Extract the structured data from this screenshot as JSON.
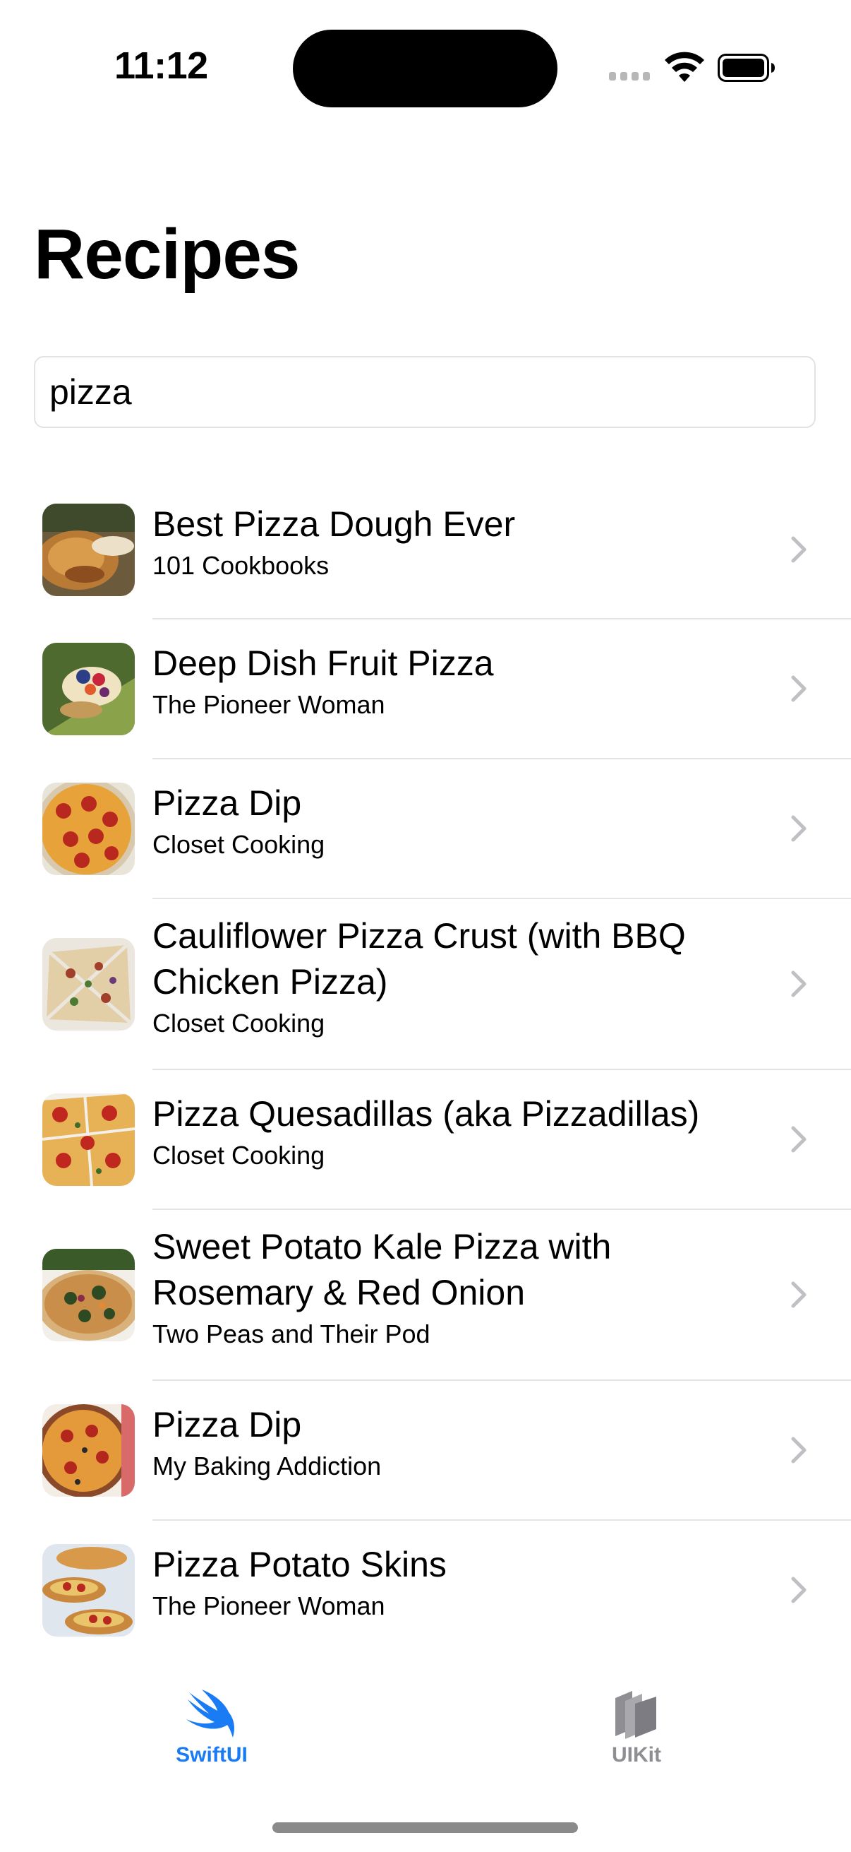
{
  "status_bar": {
    "time": "11:12"
  },
  "page_title": "Recipes",
  "search": {
    "value": "pizza",
    "placeholder": ""
  },
  "recipes": [
    {
      "title": "Best Pizza Dough Ever",
      "source": "101 Cookbooks",
      "thumbnail": "roasted-dough-photo"
    },
    {
      "title": "Deep Dish Fruit Pizza",
      "source": "The Pioneer Woman",
      "thumbnail": "fruit-pizza-photo"
    },
    {
      "title": "Pizza Dip",
      "source": "Closet Cooking",
      "thumbnail": "pepperoni-dip-photo"
    },
    {
      "title": "Cauliflower Pizza Crust (with BBQ Chicken Pizza)",
      "source": "Closet Cooking",
      "thumbnail": "cauliflower-pizza-photo"
    },
    {
      "title": "Pizza Quesadillas (aka Pizzadillas)",
      "source": "Closet Cooking",
      "thumbnail": "quesadilla-pizza-photo"
    },
    {
      "title": "Sweet Potato Kale Pizza with Rosemary & Red Onion",
      "source": "Two Peas and Their Pod",
      "thumbnail": "kale-pizza-photo"
    },
    {
      "title": "Pizza Dip",
      "source": "My Baking Addiction",
      "thumbnail": "pizza-dip-skillet-photo"
    },
    {
      "title": "Pizza Potato Skins",
      "source": "The Pioneer Woman",
      "thumbnail": "potato-skins-photo"
    }
  ],
  "tabs": [
    {
      "label": "SwiftUI",
      "icon": "swift-bird-icon",
      "selected": true
    },
    {
      "label": "UIKit",
      "icon": "uikit-layers-icon",
      "selected": false
    }
  ],
  "colors": {
    "accent": "#1a7cf5",
    "inactive_tab": "#8e8e93",
    "chevron": "#bfbfc4",
    "separator": "#e3e3e6"
  }
}
